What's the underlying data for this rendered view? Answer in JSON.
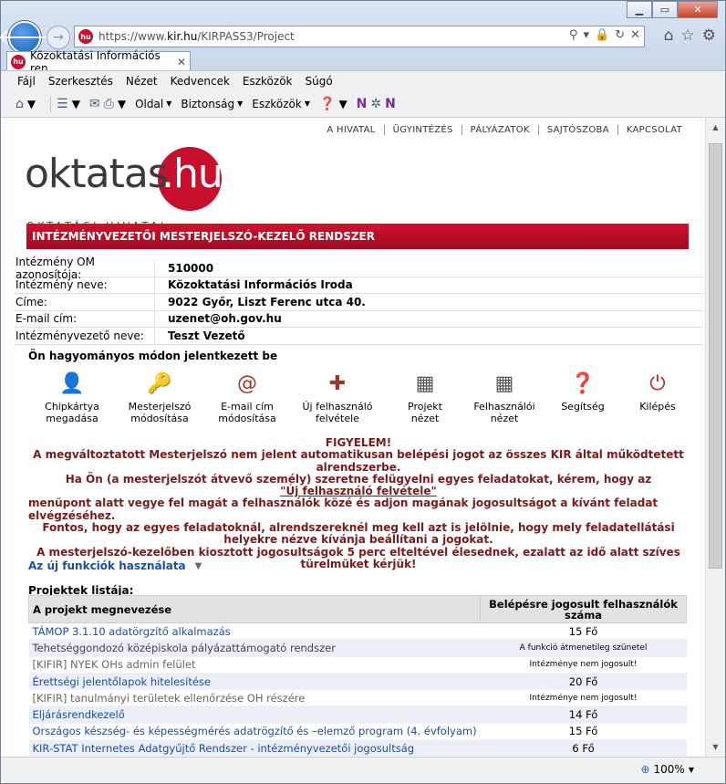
{
  "browser": {
    "url_prefix": "https://www.",
    "url_domain": "kir.hu",
    "url_path": "/KIRPASS3/Project",
    "tab_title": "Közoktatási Információs ren...",
    "favicon_text": "hu",
    "menu": [
      "Fájl",
      "Szerkesztés",
      "Nézet",
      "Kedvencek",
      "Eszközök",
      "Súgó"
    ],
    "commands": [
      "Oldal",
      "Biztonság",
      "Eszközök"
    ],
    "zoom": "100%"
  },
  "page": {
    "topnav": [
      "A HIVATAL",
      "ÜGYINTÉZÉS",
      "PÁLYÁZATOK",
      "SAJTÓSZOBA",
      "KAPCSOLAT"
    ],
    "logo": {
      "text": "oktatas",
      "hu": ".hu",
      "sub": "OKTATÁSI HIVATAL"
    },
    "system_title": "INTÉZMÉNYVEZETŐI MESTERJELSZÓ-KEZELŐ RENDSZER",
    "info": [
      {
        "label": "Intézmény OM azonosítója:",
        "value": "510000"
      },
      {
        "label": "Intézmény neve:",
        "value": "Közoktatási Információs Iroda"
      },
      {
        "label": "Címe:",
        "value": "9022 Győr, Liszt Ferenc utca 40."
      },
      {
        "label": "E-mail cím:",
        "value": "uzenet@oh.gov.hu"
      },
      {
        "label": "Intézményvezető neve:",
        "value": "Teszt Vezető"
      }
    ],
    "login_note": "Ön hagyományos módon jelentkezett be",
    "actions": [
      {
        "line1": "Chipkártya",
        "line2": "megadása"
      },
      {
        "line1": "Mesterjelszó",
        "line2": "módosítása"
      },
      {
        "line1": "E-mail cím",
        "line2": "módosítása"
      },
      {
        "line1": "Új felhasználó",
        "line2": "felvétele"
      },
      {
        "line1": "Projekt",
        "line2": "nézet"
      },
      {
        "line1": "Felhasználói",
        "line2": "nézet"
      },
      {
        "line1": "Segítség",
        "line2": ""
      },
      {
        "line1": "Kilépés",
        "line2": ""
      }
    ],
    "notice": {
      "title": "FIGYELEM!",
      "p1": "A megváltoztatott Mesterjelszó nem jelent automatikusan belépési jogot az összes KIR által működtetett alrendszerbe.",
      "p2": "Ha Ön (a mesterjelszót átvevő személy) szeretne felügyelni egyes feladatokat, kérem, hogy az",
      "link": "\"Új felhasználó felvétele\"",
      "p3": "menüpont alatt vegye fel magát a felhasználók közé és adjon magának jogosultságot a kívánt feladat elvégzéséhez.",
      "p4": "Fontos, hogy az egyes feladatoknál, alrendszereknél meg kell azt is jelölnie, hogy mely feladatellátási helyekre nézve kívánja beállítani a jogokat.",
      "p5": "A mesterjelszó-kezelőben kiosztott jogosultságok 5 perc elteltével élesednek, ezalatt az idő alatt szíves türelmüket kérjük!"
    },
    "funcs_link": "Az új funkciók használata",
    "projects_title": "Projektek listája:",
    "table": {
      "col_name": "A projekt megnevezése",
      "col_users": "Belépésre jogosult felhasználók száma",
      "rows": [
        {
          "name": "TÁMOP 3.1.10 adatörgzítő alkalmazás",
          "count": "15 Fő"
        },
        {
          "name": "Tehetséggondozó középiskola pályázattámogató rendszer",
          "count": "A funkció átmenetileg szünetel"
        },
        {
          "name": "[KIFIR] NYEK OHs admin felület",
          "count": "Intézménye nem jogosult!"
        },
        {
          "name": "Érettségi jelentőlapok hitelesítése",
          "count": "20 Fő"
        },
        {
          "name": "[KIFIR] tanulmányi területek ellenőrzése OH részére",
          "count": "Intézménye nem jogosult!"
        },
        {
          "name": "Eljárásrendkezelő",
          "count": "14 Fő"
        },
        {
          "name": "Országos készség- és képességmérés adatrögzítő és –elemző program (4. évfolyam)",
          "count": "15 Fő"
        },
        {
          "name": "KIR-STAT Internetes Adatgyűjtő Rendszer - intézményvezetői jogosultság",
          "count": "6 Fő"
        }
      ]
    }
  }
}
